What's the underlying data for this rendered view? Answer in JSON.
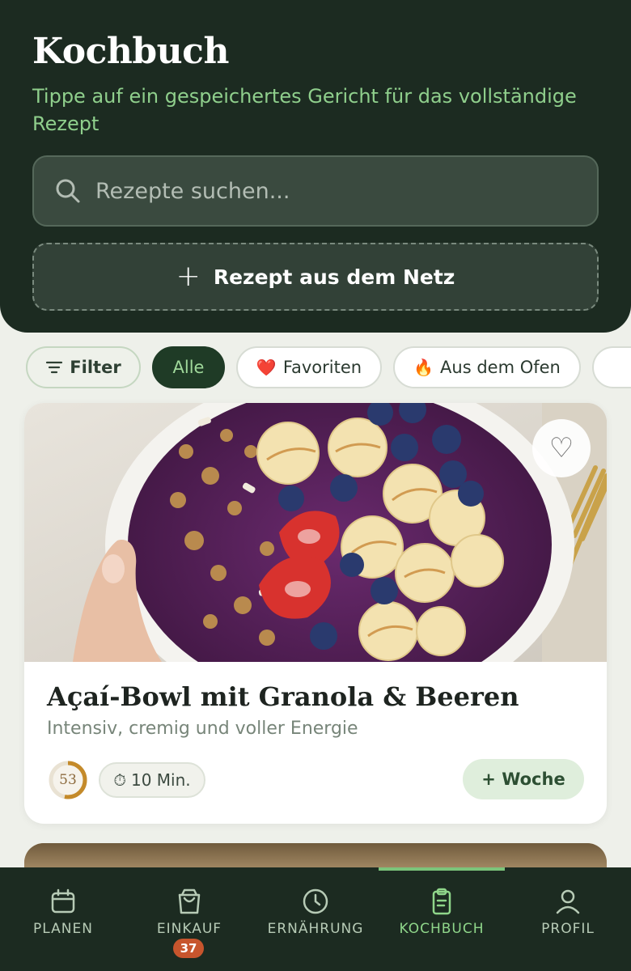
{
  "header": {
    "title": "Kochbuch",
    "subtitle": "Tippe auf ein gespeichertes Gericht für das vollständige Rezept",
    "search_placeholder": "Rezepte suchen...",
    "import_label": "Rezept aus dem Netz"
  },
  "chips": {
    "filter": "Filter",
    "all": "Alle",
    "favorites": "Favoriten",
    "favorites_icon": "❤️",
    "oven": "Aus dem Ofen",
    "oven_icon": "🔥",
    "pot_icon": "🍲"
  },
  "recipes": [
    {
      "title": "Açaí-Bowl mit Granola & Beeren",
      "subtitle": "Intensiv, cremig und voller Energie",
      "score": "53",
      "score_fraction": 0.53,
      "time_icon": "⏱",
      "time": "10 Min.",
      "week_button": "+ Woche",
      "favorite_icon": "♡"
    }
  ],
  "nav": {
    "items": [
      {
        "label": "PLANEN",
        "icon": "calendar-icon"
      },
      {
        "label": "EINKAUF",
        "icon": "shopping-bag-icon",
        "badge": "37"
      },
      {
        "label": "ERNÄHRUNG",
        "icon": "clock-icon"
      },
      {
        "label": "KOCHBUCH",
        "icon": "clipboard-icon",
        "active": true
      },
      {
        "label": "PROFIL",
        "icon": "user-icon"
      }
    ]
  },
  "colors": {
    "header_bg": "#1c2b21",
    "accent_green": "#8fcf8c",
    "badge": "#c7552d",
    "score_ring": "#c48a2a"
  }
}
